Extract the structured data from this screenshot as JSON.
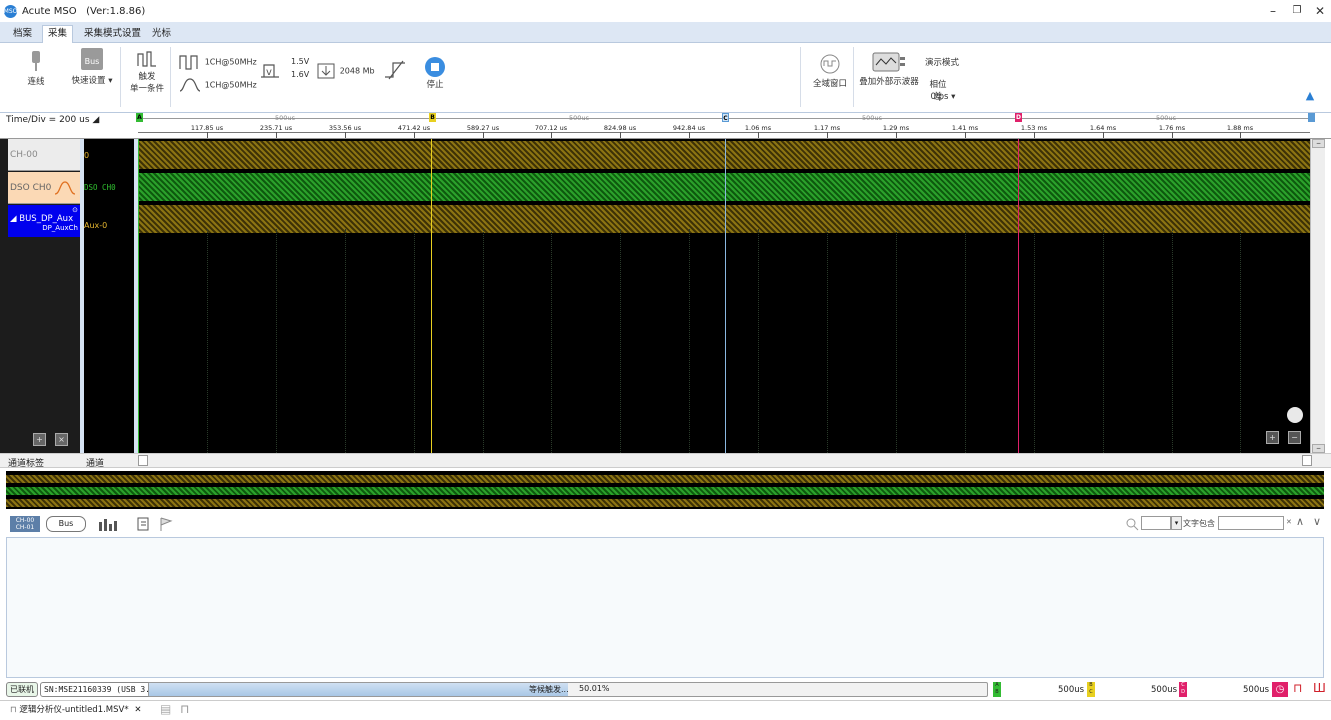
{
  "window": {
    "title": "Acute MSO",
    "version": "(Ver:1.8.86)",
    "logo": "MSO"
  },
  "menu": {
    "tabs": [
      "档案",
      "采集",
      "采集模式设置",
      "光标"
    ],
    "active": "采集"
  },
  "ribbon": {
    "connect": "连线",
    "bus_icon": "Bus",
    "quick_setup": "快速设置",
    "trigger_l1": "触发",
    "trigger_l2": "单一条件",
    "digital_rate": "1CH@50MHz",
    "analog_rate": "1CH@50MHz",
    "volt_high": "1.5V",
    "volt_low": "1.6V",
    "mem_depth": "2048 Mb",
    "stop": "停止",
    "full_window": "全域窗口",
    "overlay_scope": "叠加外部示波器",
    "demo_mode": "演示模式",
    "phase_diff": "相位差",
    "phase_value": "0 ps"
  },
  "ruler": {
    "time_div": "Time/Div = 200 us",
    "ticks": [
      "117.85 us",
      "235.71 us",
      "353.56 us",
      "471.42 us",
      "589.27 us",
      "707.12 us",
      "824.98 us",
      "942.84 us",
      "1.06 ms",
      "1.17 ms",
      "1.29 ms",
      "1.41 ms",
      "1.53 ms",
      "1.64 ms",
      "1.76 ms",
      "1.88 ms"
    ],
    "spans": [
      "500us",
      "500us",
      "500us",
      "500us"
    ],
    "cursors": [
      "A",
      "B",
      "C",
      "D"
    ]
  },
  "channels": [
    {
      "label": "CH-00",
      "value": "0"
    },
    {
      "label": "DSO CH0",
      "value": "DSO CH0"
    },
    {
      "label": "BUS_DP_Aux",
      "sub": "DP_AuxCh",
      "value": "Aux-0"
    }
  ],
  "labels": {
    "channel_tag": "通道标签",
    "channel": "通道"
  },
  "toolrow2": {
    "ch_icon_top": "CH-00",
    "ch_icon_bottom": "CH-01",
    "bus": "Bus",
    "search_text": "文字包含",
    "search_value": "",
    "combo_value": ""
  },
  "status": {
    "connected": "已联机",
    "sn": "SN:MSE21160339 (USB 3.0)",
    "waiting": "等候触发...",
    "progress_text": "50.01%",
    "progress": 0.5001,
    "ab": "500us",
    "bc": "500us",
    "cd": "500us"
  },
  "tab": {
    "name": "逻辑分析仪-untitled1.MSV*"
  },
  "colors": {
    "gold": "#8c7412",
    "green": "#2ba12b",
    "cursorA": "#33bb33",
    "cursorB": "#e8d020",
    "cursorC": "#5a9ad4",
    "cursorD": "#e0206a",
    "blue": "#0033cc"
  }
}
